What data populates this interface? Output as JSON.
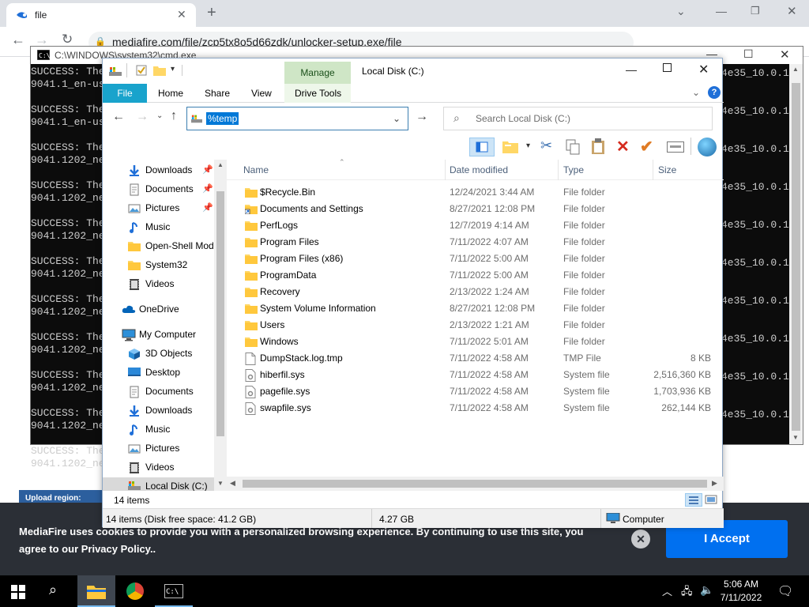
{
  "browser": {
    "tab_title": "file",
    "url": "mediafire.com/file/zcp5tx8o5d66zdk/unlocker-setup.exe/file"
  },
  "mediafire": {
    "upload_label": "Upload region:",
    "cookie_text": "MediaFire uses cookies to provide you with a personalized browsing experience. By continuing to use this site, you agree to our Privacy Policy..",
    "accept_label": "I Accept"
  },
  "cmd": {
    "title": "C:\\WINDOWS\\system32\\cmd.exe",
    "lines_left": [
      "SUCCESS: The",
      "9041.1_en-us",
      "",
      "SUCCESS: The",
      "9041.1_en-us",
      "",
      "SUCCESS: The",
      "9041.1202_ne",
      "",
      "SUCCESS: The",
      "9041.1202_ne",
      "",
      "SUCCESS: The",
      "9041.1202_ne",
      "",
      "SUCCESS: The",
      "9041.1202_ne",
      "",
      "SUCCESS: The",
      "9041.1202_ne",
      "",
      "SUCCESS: The",
      "9041.1202_ne",
      "",
      "SUCCESS: The",
      "9041.1202_ne",
      "",
      "SUCCESS: The",
      "9041.1202_ne",
      "",
      "SUCCESS: The",
      "9041.1202_ne"
    ],
    "lines_right": "4e35_10.0.1"
  },
  "explorer": {
    "manage_label": "Manage",
    "window_title": "Local Disk (C:)",
    "tabs": {
      "file": "File",
      "home": "Home",
      "share": "Share",
      "view": "View",
      "drive_tools": "Drive Tools"
    },
    "address_value": "%temp",
    "search_placeholder": "Search Local Disk (C:)",
    "nav_items": [
      {
        "label": "Downloads",
        "icon": "download-icon"
      },
      {
        "label": "Documents",
        "icon": "documents-icon"
      },
      {
        "label": "Pictures",
        "icon": "pictures-icon"
      },
      {
        "label": "Music",
        "icon": "music-icon"
      },
      {
        "label": "Open-Shell Mod",
        "icon": "folder-icon"
      },
      {
        "label": "System32",
        "icon": "folder-icon"
      },
      {
        "label": "Videos",
        "icon": "videos-icon"
      },
      {
        "label": "OneDrive",
        "icon": "cloud-icon"
      },
      {
        "label": "My Computer",
        "icon": "computer-icon"
      },
      {
        "label": "3D Objects",
        "icon": "3d-objects-icon"
      },
      {
        "label": "Desktop",
        "icon": "desktop-icon"
      },
      {
        "label": "Documents",
        "icon": "documents-icon"
      },
      {
        "label": "Downloads",
        "icon": "download-icon"
      },
      {
        "label": "Music",
        "icon": "music-icon"
      },
      {
        "label": "Pictures",
        "icon": "pictures-icon"
      },
      {
        "label": "Videos",
        "icon": "videos-icon"
      },
      {
        "label": "Local Disk (C:)",
        "icon": "drive-icon"
      }
    ],
    "columns": {
      "name": "Name",
      "date": "Date modified",
      "type": "Type",
      "size": "Size"
    },
    "files": [
      {
        "name": "$Recycle.Bin",
        "date": "12/24/2021 3:44 AM",
        "type": "File folder",
        "size": "",
        "icon": "folder-icon"
      },
      {
        "name": "Documents and Settings",
        "date": "8/27/2021 12:08 PM",
        "type": "File folder",
        "size": "",
        "icon": "folder-shortcut-icon"
      },
      {
        "name": "PerfLogs",
        "date": "12/7/2019 4:14 AM",
        "type": "File folder",
        "size": "",
        "icon": "folder-icon"
      },
      {
        "name": "Program Files",
        "date": "7/11/2022 4:07 AM",
        "type": "File folder",
        "size": "",
        "icon": "folder-icon"
      },
      {
        "name": "Program Files (x86)",
        "date": "7/11/2022 5:00 AM",
        "type": "File folder",
        "size": "",
        "icon": "folder-icon"
      },
      {
        "name": "ProgramData",
        "date": "7/11/2022 5:00 AM",
        "type": "File folder",
        "size": "",
        "icon": "folder-icon"
      },
      {
        "name": "Recovery",
        "date": "2/13/2022 1:24 AM",
        "type": "File folder",
        "size": "",
        "icon": "folder-icon"
      },
      {
        "name": "System Volume Information",
        "date": "8/27/2021 12:08 PM",
        "type": "File folder",
        "size": "",
        "icon": "folder-icon"
      },
      {
        "name": "Users",
        "date": "2/13/2022 1:21 AM",
        "type": "File folder",
        "size": "",
        "icon": "folder-icon"
      },
      {
        "name": "Windows",
        "date": "7/11/2022 5:01 AM",
        "type": "File folder",
        "size": "",
        "icon": "folder-icon"
      },
      {
        "name": "DumpStack.log.tmp",
        "date": "7/11/2022 4:58 AM",
        "type": "TMP File",
        "size": "8 KB",
        "icon": "file-icon"
      },
      {
        "name": "hiberfil.sys",
        "date": "7/11/2022 4:58 AM",
        "type": "System file",
        "size": "2,516,360 KB",
        "icon": "system-file-icon"
      },
      {
        "name": "pagefile.sys",
        "date": "7/11/2022 4:58 AM",
        "type": "System file",
        "size": "1,703,936 KB",
        "icon": "system-file-icon"
      },
      {
        "name": "swapfile.sys",
        "date": "7/11/2022 4:58 AM",
        "type": "System file",
        "size": "262,144 KB",
        "icon": "system-file-icon"
      }
    ],
    "item_count": "14 items",
    "detail_items": "14 items (Disk free space: 41.2 GB)",
    "detail_size": "4.27 GB",
    "detail_location": "Computer"
  },
  "taskbar": {
    "time": "5:06 AM",
    "date": "7/11/2022"
  },
  "colors": {
    "accent": "#0078d7",
    "file_tab": "#19a3cc",
    "manage_tab": "#cfe6c6",
    "folder": "#ffd766",
    "cookie_button": "#0070f0"
  }
}
